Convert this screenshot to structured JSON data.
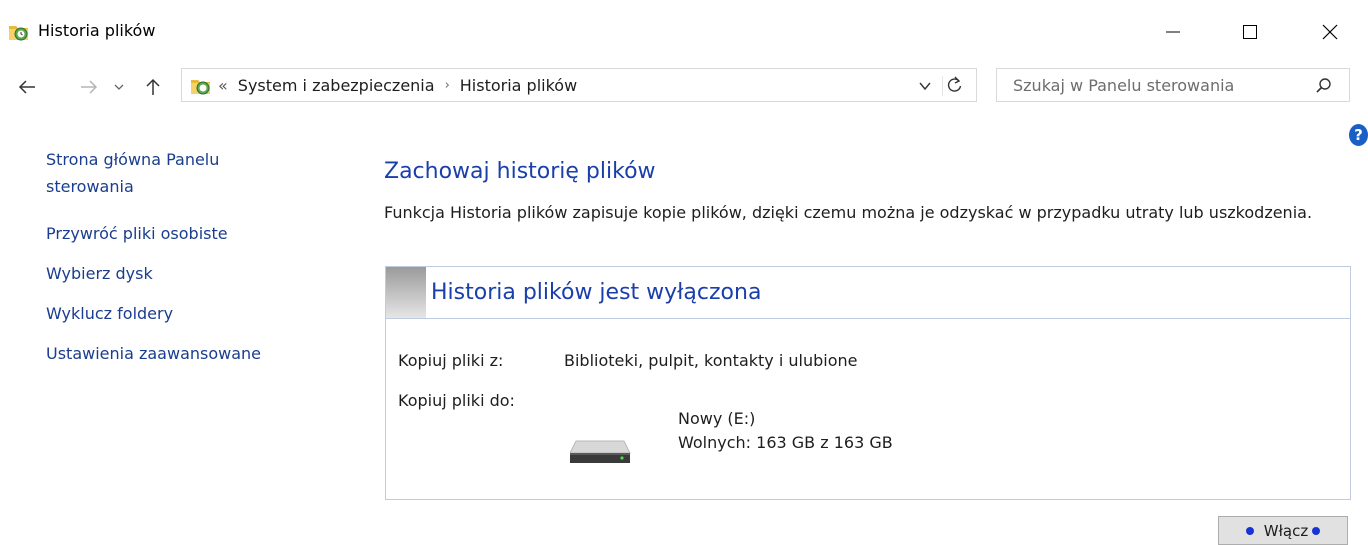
{
  "window": {
    "title": "Historia plików",
    "icon": "file-history-icon",
    "controls": [
      "minimize-icon",
      "maximize-icon",
      "close-icon"
    ]
  },
  "navigation": {
    "address_icon": "control-panel-icon",
    "breadcrumb_prefix": "«",
    "breadcrumbs": [
      "System i zabezpieczenia",
      "Historia plików"
    ],
    "search_placeholder": "Szukaj w Panelu sterowania"
  },
  "sidebar": {
    "items": [
      {
        "label": "Strona główna Panelu sterowania"
      },
      {
        "label": "Przywróć pliki osobiste"
      },
      {
        "label": "Wybierz dysk"
      },
      {
        "label": "Wyklucz foldery"
      },
      {
        "label": "Ustawienia zaawansowane"
      }
    ]
  },
  "main": {
    "heading": "Zachowaj historię plików",
    "description": "Funkcja Historia plików zapisuje kopie plików, dzięki czemu można je odzyskać w przypadku utraty lub uszkodzenia.",
    "status_title": "Historia plików jest wyłączona",
    "copy_from_label": "Kopiuj pliki z:",
    "copy_from_value": "Biblioteki, pulpit, kontakty i ulubione",
    "copy_to_label": "Kopiuj pliki do:",
    "drive_name": "Nowy (E:)",
    "drive_free": "Wolnych: 163 GB z 163 GB",
    "enable_button": "Włącz"
  },
  "colors": {
    "link": "#1a3d8f",
    "heading": "#1a3fab",
    "panel_border": "#bfcce0",
    "button_dot": "#1733d6"
  }
}
